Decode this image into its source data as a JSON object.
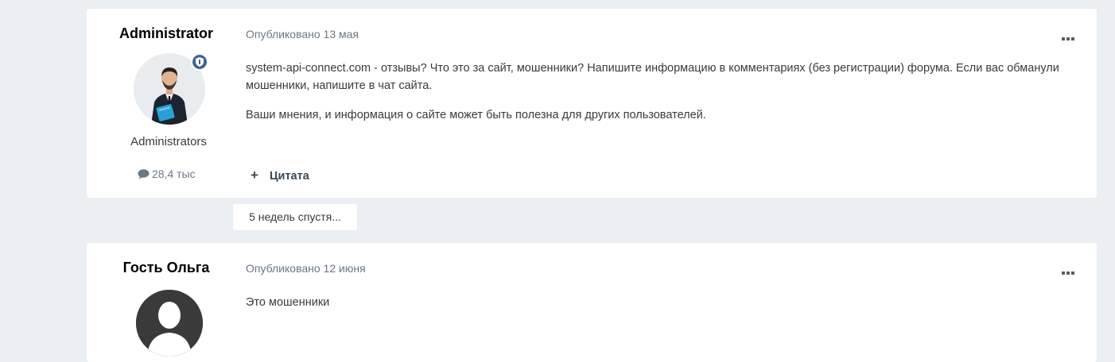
{
  "posts": [
    {
      "author": "Administrator",
      "avatar_icon": "user-photo-avatar",
      "badge_icon": "shield-icon",
      "group": "Administrators",
      "post_count": "28,4 тыс",
      "published": "Опубликовано 13 мая",
      "paragraphs": [
        "system-api-connect.com - отзывы? Что это за сайт, мошенники? Напишите информацию в комментариях (без регистрации) форума. Если вас обманули мошенники, напишите в чат сайта.",
        "Ваши мнения, и информация о сайте может быть полезна для других пользователей."
      ],
      "quote_plus": "+",
      "quote_label": "Цитата"
    },
    {
      "author": "Гость Ольга",
      "avatar_icon": "default-user-avatar",
      "published": "Опубликовано 12 июня",
      "paragraphs": [
        "Это мошенники"
      ]
    }
  ],
  "time_gap": "5 недель спустя...",
  "colors": {
    "page_bg": "#ebeef2",
    "card_bg": "#ffffff",
    "meta_text": "#6b7785",
    "badge": "#3d6594"
  }
}
